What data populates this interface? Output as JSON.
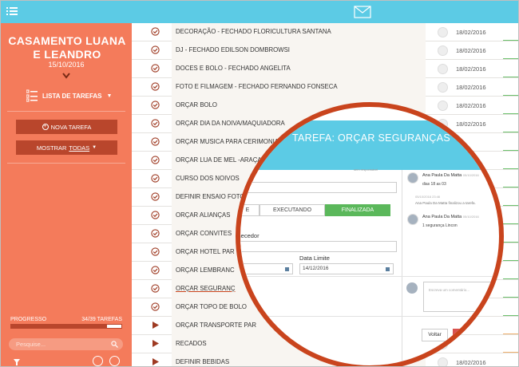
{
  "event": {
    "title": "CASAMENTO LUANA E LEANDRO",
    "date": "15/10/2016"
  },
  "sidebar": {
    "list_label": "LISTA DE TAREFAS",
    "new_task_label": "NOVA TAREFA",
    "show_prefix": "MOSTRAR",
    "show_value": "TODAS",
    "progress_label": "PROGRESSO",
    "progress_count": "34/39 TAREFAS",
    "progress_fraction": 0.87,
    "search_placeholder": "Pesquise..."
  },
  "tasks": [
    {
      "name": "DECORAÇÃO - FECHADO FLORICULTURA SANTANA",
      "date": "18/02/2016",
      "status": "done"
    },
    {
      "name": "DJ - FECHADO EDILSON DOMBROWSI",
      "date": "18/02/2016",
      "status": "done"
    },
    {
      "name": "DOCES E BOLO - FECHADO ANGELITA",
      "date": "18/02/2016",
      "status": "done"
    },
    {
      "name": "FOTO E FILMAGEM - FECHADO FERNANDO FONSECA",
      "date": "18/02/2016",
      "status": "done"
    },
    {
      "name": "ORÇAR BOLO",
      "date": "18/02/2016",
      "status": "done"
    },
    {
      "name": "ORÇAR DIA DA NOIVA/MAQUIADORA",
      "date": "18/02/2016",
      "status": "done"
    },
    {
      "name": "ORÇAR MUSICA PARA CERIMONIA",
      "date": "",
      "status": "done"
    },
    {
      "name": "ORÇAR LUA DE MEL -ARAÇA",
      "date": "",
      "status": "done"
    },
    {
      "name": "CURSO DOS NOIVOS",
      "date": "",
      "status": "done"
    },
    {
      "name": "DEFINIR ENSAIO FOTO",
      "date": "",
      "status": "done"
    },
    {
      "name": "ORÇAR ALIANÇAS",
      "date": "",
      "status": "done"
    },
    {
      "name": "ORÇAR CONVITES",
      "date": "",
      "status": "done"
    },
    {
      "name": "ORÇAR HOTEL PAR",
      "date": "",
      "status": "done"
    },
    {
      "name": "ORÇAR LEMBRANC",
      "date": "",
      "status": "done"
    },
    {
      "name": "ORÇAR SEGURANÇ",
      "date": "",
      "status": "done"
    },
    {
      "name": "ORÇAR TOPO DE BOLO",
      "date": "",
      "status": "done"
    },
    {
      "name": "ORÇAR TRANSPORTE PAR",
      "date": "",
      "status": "pending"
    },
    {
      "name": "RECADOS",
      "date": "",
      "status": "pending"
    },
    {
      "name": "DEFINIR BEBIDAS",
      "date": "18/02/2016",
      "status": "pending"
    }
  ],
  "modal": {
    "title": "TAREFA: ORÇAR SEGURANÇAS",
    "responsible_label": "sem responsável",
    "name_field_value": "S",
    "tabs": [
      {
        "label": "E",
        "active": false
      },
      {
        "label": "EXECUTANDO",
        "active": false
      },
      {
        "label": "FINALIZADA",
        "active": true
      }
    ],
    "supplier_label": "rnecedor",
    "deadline_label": "Data Limite",
    "deadline_value": "14/12/2016",
    "comments": [
      {
        "author": "Ana Paula Da Matta",
        "date": "05/10/2016",
        "text": "dias 18 as 03"
      },
      {
        "author": "Ana Paula Da Matta",
        "date": "05/10/2016",
        "text": "1 segurança Lincon"
      }
    ],
    "system_message": "Ana Paula Da Matta finalizou a tarefa.",
    "system_message_date": "05/10/2016 23:46",
    "comment_placeholder": "Escreva um comentário...",
    "back_label": "Voltar",
    "remove_label": "Re"
  },
  "colors": {
    "topbar": "#5ccbe5",
    "sidebar": "#f47b5b",
    "dark_button": "#b9462c",
    "finalized": "#5bb85b",
    "circle": "#c9441d",
    "remove": "#d9534f"
  }
}
